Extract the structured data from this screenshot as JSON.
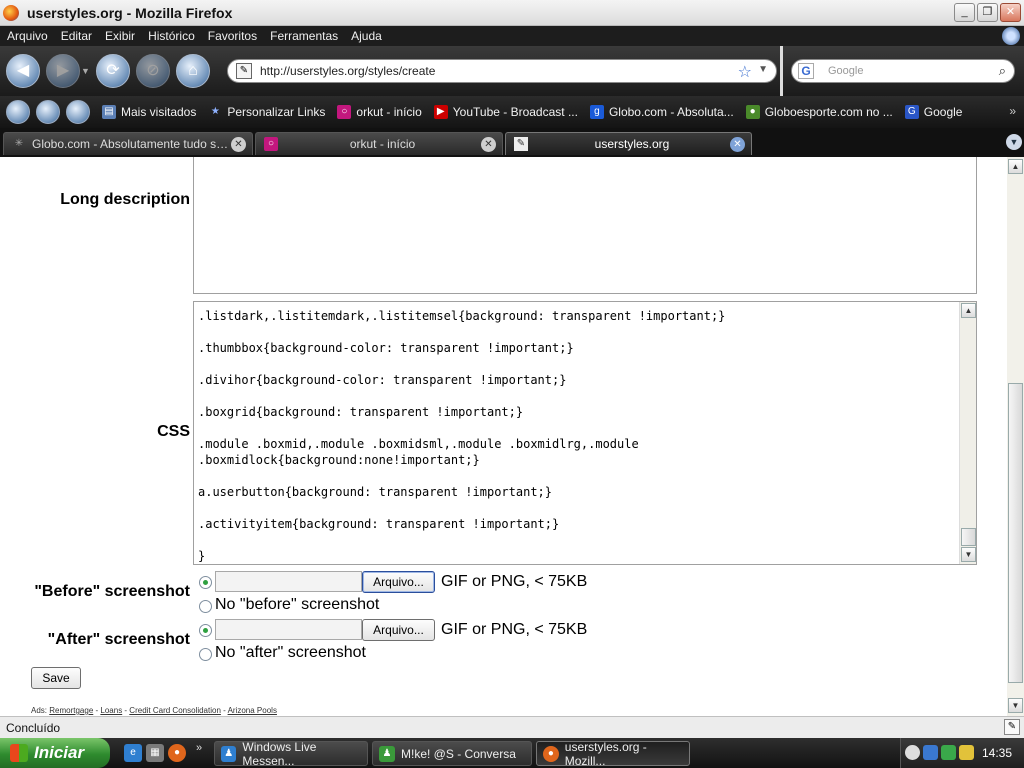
{
  "window": {
    "title": "userstyles.org - Mozilla Firefox"
  },
  "menu": [
    "Arquivo",
    "Editar",
    "Exibir",
    "Histórico",
    "Favoritos",
    "Ferramentas",
    "Ajuda"
  ],
  "nav": {
    "url": "http://userstyles.org/styles/create",
    "search_placeholder": "Google",
    "search_engine_letter": "G"
  },
  "bookmarks": [
    {
      "label": "Mais visitados",
      "icon": "folder-icon"
    },
    {
      "label": "Personalizar Links",
      "icon": "star-icon"
    },
    {
      "label": "orkut - início",
      "icon": "orkut-icon"
    },
    {
      "label": "YouTube - Broadcast ...",
      "icon": "youtube-icon"
    },
    {
      "label": "Globo.com - Absoluta...",
      "icon": "globo-icon"
    },
    {
      "label": "Globoesporte.com no ...",
      "icon": "globoesporte-icon"
    },
    {
      "label": "Google",
      "icon": "google-icon"
    }
  ],
  "tabs": [
    {
      "label": "Globo.com - Absolutamente tudo sobre..."
    },
    {
      "label": "orkut - início"
    },
    {
      "label": "userstyles.org"
    }
  ],
  "form": {
    "long_description_label": "Long description",
    "css_label": "CSS",
    "css_lines": [
      ".listdark,.listitemdark,.listitemsel{background: transparent !important;}",
      "",
      ".thumbbox{background-color: transparent !important;}",
      "",
      ".divihor{background-color: transparent !important;}",
      "",
      ".boxgrid{background: transparent !important;}",
      "",
      ".module .boxmid,.module .boxmidsml,.module .boxmidlrg,.module",
      ".boxmidlock{background:none!important;}",
      "",
      "a.userbutton{background: transparent !important;}",
      "",
      ".activityitem{background: transparent !important;}",
      "",
      "}"
    ],
    "before_label": "\"Before\" screenshot",
    "after_label": "\"After\" screenshot",
    "browse_button": "Arquivo...",
    "file_hint": "GIF or PNG, < 75KB",
    "no_before": "No \"before\" screenshot",
    "no_after": "No \"after\" screenshot",
    "save_button": "Save",
    "ads_prefix": "Ads:",
    "ads": [
      "Remortgage",
      "Loans",
      "Credit Card Consolidation",
      "Arizona Pools"
    ]
  },
  "status": {
    "text": "Concluído"
  },
  "taskbar": {
    "start_label": "Iniciar",
    "tasks": [
      {
        "label": "Windows Live Messen...",
        "color": "#2f7fd0"
      },
      {
        "label": "M!ke! @S - Conversa",
        "color": "#3a9a3a"
      },
      {
        "label": "userstyles.org - Mozill...",
        "color": "#e0661c"
      }
    ],
    "clock": "14:35"
  },
  "colors": {
    "accent": "#3b6fcf",
    "start_green": "#2e8b2e",
    "radio_dot": "#2fa040"
  }
}
